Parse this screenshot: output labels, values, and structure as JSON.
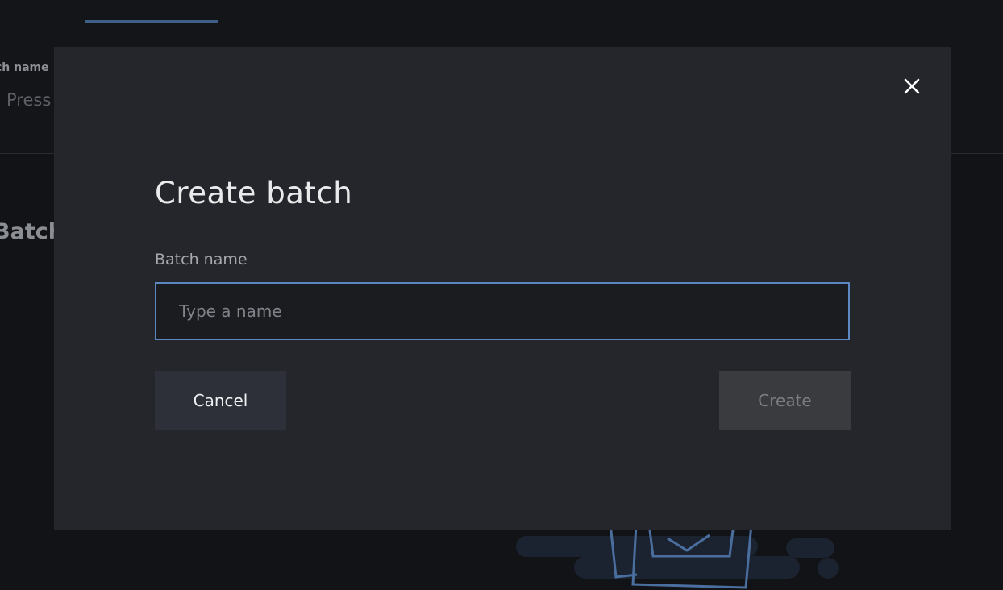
{
  "background": {
    "field_label": "ch name",
    "field_placeholder": "Press",
    "section_heading": "Batch"
  },
  "dialog": {
    "title": "Create batch",
    "close_icon": "close-icon",
    "name_field": {
      "label": "Batch name",
      "placeholder": "Type a name",
      "value": ""
    },
    "cancel_label": "Cancel",
    "create_label": "Create",
    "create_enabled": false
  },
  "colors": {
    "accent": "#5b88c1",
    "dialog_background": "#25262b",
    "page_background": "#121316"
  }
}
